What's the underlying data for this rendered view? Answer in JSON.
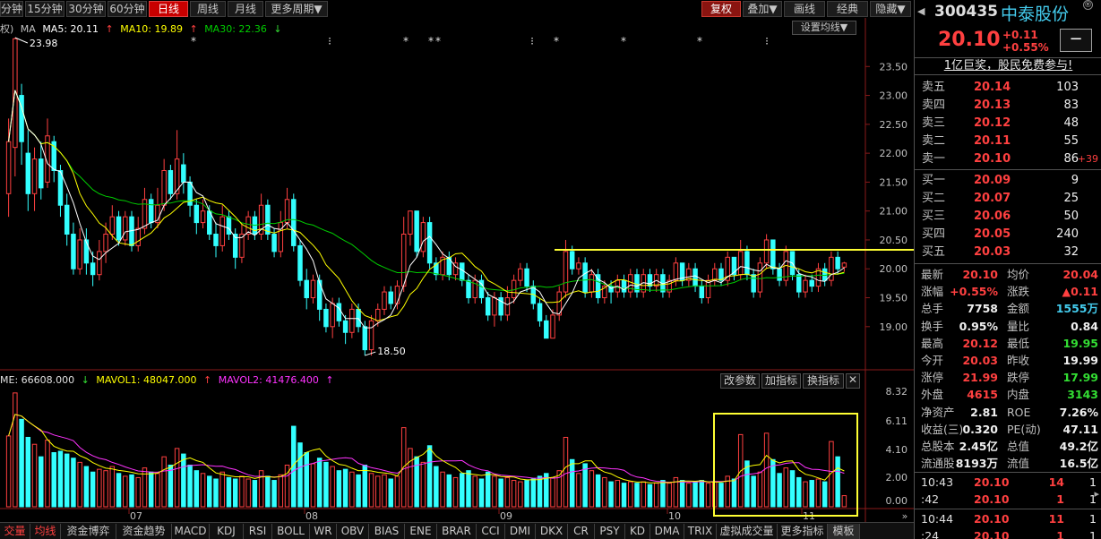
{
  "toolbar": {
    "periods": [
      {
        "label": "分钟",
        "active": false
      },
      {
        "label": "15分钟",
        "active": false
      },
      {
        "label": "30分钟",
        "active": false
      },
      {
        "label": "60分钟",
        "active": false
      },
      {
        "label": "日线",
        "active": true
      },
      {
        "label": "周线",
        "active": false
      },
      {
        "label": "月线",
        "active": false
      },
      {
        "label": "更多周期▼",
        "active": false
      }
    ],
    "right_buttons": [
      "复权",
      "叠加▼",
      "画线",
      "经典",
      "隐藏▼"
    ]
  },
  "main_legend": {
    "prefix": "权)",
    "ma_label": "MA",
    "ma5": "MA5: 20.11",
    "ma10": "MA10: 19.89",
    "ma30": "MA30: 22.36",
    "up_arrow": "↑",
    "down_arrow": "↓"
  },
  "set_ma_button": "设置均线▼",
  "high_label": "23.98",
  "low_label": "18.50",
  "price_axis": [
    "23.50",
    "23.00",
    "22.50",
    "22.00",
    "21.50",
    "21.00",
    "20.50",
    "20.00",
    "19.50",
    "19.00"
  ],
  "volume_legend": {
    "vol": "ME: 66608.000",
    "mavol1": "MAVOL1: 48047.000",
    "mavol2": "MAVOL2: 41476.400",
    "down_arrow": "↓",
    "up_arrow": "↑"
  },
  "volume_axis": [
    "8.32",
    "6.11",
    "4.10",
    "2.00",
    "0.00"
  ],
  "volume_buttons": [
    "改参数",
    "加指标",
    "换指标"
  ],
  "date_axis": [
    "07",
    "08",
    "09",
    "10",
    "11"
  ],
  "bottom_tabs": [
    "交量",
    "均线",
    "资金博弈",
    "资金趋势",
    "MACD",
    "KDJ",
    "RSI",
    "BOLL",
    "WR",
    "OBV",
    "BIAS",
    "ENE",
    "BRAR",
    "CCI",
    "DMI",
    "DKX",
    "CR",
    "PSY",
    "KD",
    "DMA",
    "TRIX",
    "虚拟成交量",
    "更多指标",
    "模板"
  ],
  "colors": {
    "up": "#ff4040",
    "down": "#33ffff",
    "ma5": "#ffffff",
    "ma10": "#ffff00",
    "ma30": "#00cc00",
    "mavol2": "#ff33ff",
    "annotation": "#ffff33"
  },
  "panel": {
    "code": "300435",
    "name": "中泰股份",
    "badge": "®",
    "price": "20.10",
    "change": "+0.11",
    "change_pct": "+0.55%",
    "minus": "−",
    "ad": "1亿巨奖，股民免费参与!",
    "asks": [
      {
        "label": "卖五",
        "price": "20.14",
        "vol": "103",
        "chg": ""
      },
      {
        "label": "卖四",
        "price": "20.13",
        "vol": "83",
        "chg": ""
      },
      {
        "label": "卖三",
        "price": "20.12",
        "vol": "48",
        "chg": ""
      },
      {
        "label": "卖二",
        "price": "20.11",
        "vol": "55",
        "chg": ""
      },
      {
        "label": "卖一",
        "price": "20.10",
        "vol": "86",
        "chg": "+39"
      }
    ],
    "bids": [
      {
        "label": "买一",
        "price": "20.09",
        "vol": "9"
      },
      {
        "label": "买二",
        "price": "20.07",
        "vol": "25"
      },
      {
        "label": "买三",
        "price": "20.06",
        "vol": "50"
      },
      {
        "label": "买四",
        "price": "20.05",
        "vol": "240"
      },
      {
        "label": "买五",
        "price": "20.03",
        "vol": "32"
      }
    ],
    "stats": [
      {
        "l1": "最新",
        "v1": "20.10",
        "c1": "red",
        "l2": "均价",
        "v2": "20.04",
        "c2": "red"
      },
      {
        "l1": "涨幅",
        "v1": "+0.55%",
        "c1": "red",
        "l2": "涨跌",
        "v2": "▲0.11",
        "c2": "red"
      },
      {
        "l1": "总手",
        "v1": "7758",
        "c1": "wht",
        "l2": "金额",
        "v2": "1555万",
        "c2": "cyan"
      },
      {
        "l1": "换手",
        "v1": "0.95%",
        "c1": "wht",
        "l2": "量比",
        "v2": "0.84",
        "c2": "wht"
      },
      {
        "l1": "最高",
        "v1": "20.12",
        "c1": "red",
        "l2": "最低",
        "v2": "19.95",
        "c2": "grn"
      },
      {
        "l1": "今开",
        "v1": "20.03",
        "c1": "red",
        "l2": "昨收",
        "v2": "19.99",
        "c2": "wht"
      },
      {
        "l1": "涨停",
        "v1": "21.99",
        "c1": "red",
        "l2": "跌停",
        "v2": "17.99",
        "c2": "grn"
      },
      {
        "l1": "外盘",
        "v1": "4615",
        "c1": "red",
        "l2": "内盘",
        "v2": "3143",
        "c2": "grn"
      },
      {
        "l1": "净资产",
        "v1": "2.81",
        "c1": "wht",
        "l2": "ROE",
        "v2": "7.26%",
        "c2": "wht"
      },
      {
        "l1": "收益(三)",
        "v1": "0.320",
        "c1": "wht",
        "l2": "PE(动)",
        "v2": "47.11",
        "c2": "wht"
      },
      {
        "l1": "总股本",
        "v1": "2.45亿",
        "c1": "wht",
        "l2": "总值",
        "v2": "49.2亿",
        "c2": "wht"
      },
      {
        "l1": "流通股",
        "v1": "8193万",
        "c1": "wht",
        "l2": "流值",
        "v2": "16.5亿",
        "c2": "wht"
      }
    ],
    "ticks": [
      {
        "time": "10:43",
        "price": "20.10",
        "vol": "14",
        "n": "1"
      },
      {
        "time": ":42",
        "price": "20.10",
        "vol": "1",
        "n": "1"
      },
      {
        "time": "10:44",
        "price": "20.10",
        "vol": "11",
        "n": "1"
      },
      {
        "time": ":24",
        "price": "20.10",
        "vol": "1",
        "n": "1"
      }
    ]
  },
  "chart_data": {
    "type": "candlestick",
    "price_range": [
      18.3,
      24.0
    ],
    "volume_range": [
      0,
      8.32
    ],
    "resistance_line": 20.33,
    "candles": [
      [
        21.3,
        22.2,
        22.6,
        20.9,
        5.1
      ],
      [
        22.1,
        23.98,
        24.0,
        21.6,
        8.2
      ],
      [
        23.0,
        22.2,
        23.2,
        21.8,
        6.3
      ],
      [
        22.0,
        21.3,
        22.4,
        21.0,
        5.0
      ],
      [
        21.3,
        21.9,
        22.1,
        21.0,
        4.5
      ],
      [
        21.9,
        21.4,
        22.2,
        21.2,
        3.6
      ],
      [
        21.5,
        22.3,
        22.6,
        21.4,
        4.8
      ],
      [
        22.2,
        21.7,
        22.3,
        21.5,
        3.9
      ],
      [
        21.7,
        21.1,
        21.8,
        20.9,
        4.0
      ],
      [
        21.1,
        20.6,
        21.3,
        20.4,
        3.8
      ],
      [
        20.6,
        20.0,
        20.8,
        19.9,
        3.5
      ],
      [
        20.0,
        20.5,
        20.7,
        19.9,
        3.2
      ],
      [
        20.5,
        20.1,
        20.7,
        19.9,
        2.9
      ],
      [
        20.1,
        19.9,
        20.3,
        19.7,
        2.5
      ],
      [
        19.9,
        20.3,
        20.5,
        19.8,
        2.7
      ],
      [
        20.3,
        20.6,
        20.8,
        20.1,
        2.6
      ],
      [
        20.6,
        20.9,
        21.1,
        20.5,
        2.9
      ],
      [
        20.9,
        20.5,
        21.0,
        20.4,
        2.4
      ],
      [
        20.5,
        20.9,
        21.0,
        20.4,
        2.2
      ],
      [
        20.9,
        20.4,
        21.0,
        20.3,
        2.3
      ],
      [
        20.4,
        20.7,
        20.9,
        20.3,
        2.1
      ],
      [
        20.7,
        21.2,
        21.4,
        20.6,
        2.8
      ],
      [
        21.2,
        20.8,
        21.3,
        20.7,
        2.5
      ],
      [
        20.8,
        21.1,
        21.4,
        20.7,
        2.4
      ],
      [
        21.1,
        21.7,
        21.9,
        21.0,
        3.6
      ],
      [
        21.7,
        21.3,
        21.8,
        21.2,
        3.0
      ],
      [
        21.3,
        21.9,
        22.4,
        21.2,
        4.2
      ],
      [
        21.8,
        21.5,
        22.0,
        21.3,
        3.8
      ],
      [
        21.5,
        21.1,
        21.6,
        20.9,
        3.0
      ],
      [
        21.1,
        20.8,
        21.2,
        20.6,
        2.6
      ],
      [
        20.8,
        21.0,
        21.2,
        20.7,
        2.4
      ],
      [
        21.0,
        20.6,
        21.1,
        20.5,
        2.2
      ],
      [
        20.6,
        20.4,
        20.8,
        20.2,
        2.0
      ],
      [
        20.4,
        20.9,
        21.1,
        20.3,
        2.5
      ],
      [
        20.9,
        20.6,
        21.0,
        20.5,
        2.1
      ],
      [
        20.6,
        20.2,
        20.7,
        20.0,
        2.0
      ],
      [
        20.2,
        20.6,
        20.8,
        20.1,
        2.2
      ],
      [
        20.6,
        20.9,
        21.0,
        20.5,
        2.0
      ],
      [
        20.9,
        20.6,
        21.0,
        20.5,
        1.9
      ],
      [
        20.6,
        21.1,
        21.3,
        20.5,
        2.6
      ],
      [
        21.1,
        20.6,
        21.2,
        20.5,
        2.2
      ],
      [
        20.6,
        20.3,
        20.7,
        20.2,
        1.9
      ],
      [
        20.3,
        20.8,
        21.0,
        20.2,
        2.3
      ],
      [
        20.8,
        21.2,
        21.4,
        20.7,
        3.0
      ],
      [
        21.2,
        20.4,
        21.3,
        20.3,
        5.8
      ],
      [
        20.4,
        19.8,
        20.5,
        19.7,
        4.6
      ],
      [
        19.8,
        19.5,
        20.0,
        19.3,
        3.9
      ],
      [
        19.5,
        19.8,
        19.9,
        19.4,
        3.1
      ],
      [
        19.8,
        19.3,
        19.9,
        19.1,
        3.5
      ],
      [
        19.3,
        19.0,
        19.4,
        18.9,
        3.2
      ],
      [
        19.0,
        19.4,
        19.5,
        18.8,
        2.9
      ],
      [
        19.4,
        19.1,
        19.5,
        19.0,
        2.6
      ],
      [
        19.1,
        18.9,
        19.2,
        18.7,
        2.7
      ],
      [
        18.9,
        19.3,
        19.4,
        18.8,
        2.5
      ],
      [
        19.3,
        19.0,
        19.4,
        18.9,
        2.3
      ],
      [
        19.0,
        18.6,
        19.1,
        18.5,
        3.0
      ],
      [
        18.6,
        19.1,
        19.2,
        18.5,
        2.4
      ],
      [
        19.1,
        19.3,
        19.4,
        19.0,
        2.2
      ],
      [
        19.3,
        19.6,
        19.7,
        19.2,
        2.3
      ],
      [
        19.6,
        19.4,
        19.7,
        19.3,
        2.0
      ],
      [
        19.4,
        19.7,
        19.8,
        19.3,
        2.2
      ],
      [
        19.7,
        20.6,
        20.9,
        19.6,
        5.7
      ],
      [
        20.6,
        21.0,
        21.0,
        20.4,
        4.2
      ],
      [
        21.0,
        20.3,
        21.0,
        20.2,
        3.6
      ],
      [
        20.3,
        20.8,
        20.9,
        20.2,
        3.2
      ],
      [
        20.8,
        20.1,
        20.9,
        20.0,
        4.4
      ],
      [
        20.1,
        19.9,
        20.2,
        19.8,
        2.9
      ],
      [
        19.9,
        20.2,
        20.3,
        19.8,
        2.5
      ],
      [
        20.2,
        19.9,
        20.3,
        19.8,
        2.3
      ],
      [
        19.9,
        20.1,
        20.2,
        19.8,
        2.1
      ],
      [
        20.1,
        19.8,
        20.1,
        19.7,
        2.4
      ],
      [
        19.8,
        19.5,
        19.9,
        19.4,
        2.6
      ],
      [
        19.5,
        19.8,
        19.9,
        19.4,
        2.2
      ],
      [
        19.8,
        19.5,
        19.9,
        19.4,
        2.0
      ],
      [
        19.5,
        19.2,
        19.6,
        19.1,
        2.5
      ],
      [
        19.2,
        19.5,
        19.6,
        19.0,
        2.2
      ],
      [
        19.5,
        19.2,
        19.6,
        19.1,
        2.0
      ],
      [
        19.2,
        19.5,
        19.7,
        19.1,
        2.1
      ],
      [
        19.5,
        19.8,
        19.9,
        19.4,
        1.9
      ],
      [
        19.8,
        20.0,
        20.1,
        19.7,
        1.8
      ],
      [
        20.0,
        19.7,
        20.1,
        19.6,
        1.9
      ],
      [
        19.7,
        19.4,
        19.8,
        19.3,
        2.0
      ],
      [
        19.4,
        19.1,
        19.5,
        19.0,
        2.2
      ],
      [
        19.1,
        18.8,
        19.2,
        18.8,
        2.4
      ],
      [
        18.8,
        19.2,
        19.3,
        18.8,
        2.1
      ],
      [
        19.2,
        19.6,
        19.7,
        19.1,
        2.6
      ],
      [
        19.6,
        20.3,
        20.5,
        19.5,
        5.0
      ],
      [
        20.3,
        20.0,
        20.4,
        19.9,
        3.4
      ],
      [
        20.0,
        20.1,
        20.2,
        19.9,
        2.4
      ],
      [
        20.1,
        19.6,
        20.2,
        19.5,
        3.1
      ],
      [
        19.6,
        19.9,
        20.0,
        19.5,
        2.6
      ],
      [
        19.9,
        19.5,
        20.0,
        19.4,
        2.3
      ],
      [
        19.5,
        19.7,
        19.8,
        19.4,
        2.1
      ],
      [
        19.7,
        19.6,
        19.8,
        19.4,
        1.8
      ],
      [
        19.6,
        19.8,
        19.9,
        19.5,
        1.9
      ],
      [
        19.8,
        19.6,
        19.9,
        19.5,
        1.7
      ],
      [
        19.6,
        19.9,
        20.0,
        19.5,
        1.8
      ],
      [
        19.9,
        19.6,
        20.0,
        19.5,
        1.7
      ],
      [
        19.6,
        19.9,
        20.0,
        19.5,
        1.8
      ],
      [
        19.9,
        19.7,
        20.0,
        19.6,
        1.6
      ],
      [
        19.7,
        19.9,
        20.0,
        19.6,
        1.7
      ],
      [
        19.9,
        19.6,
        20.0,
        19.5,
        1.9
      ],
      [
        19.6,
        19.8,
        19.9,
        19.5,
        1.7
      ],
      [
        19.8,
        20.1,
        20.2,
        19.7,
        2.1
      ],
      [
        20.1,
        19.8,
        20.1,
        19.7,
        1.9
      ],
      [
        19.8,
        20.0,
        20.1,
        19.7,
        1.7
      ],
      [
        20.0,
        19.7,
        20.1,
        19.6,
        1.8
      ],
      [
        19.7,
        19.5,
        19.8,
        19.4,
        1.9
      ],
      [
        19.5,
        19.8,
        19.9,
        19.4,
        1.7
      ],
      [
        19.8,
        20.0,
        20.1,
        19.7,
        1.8
      ],
      [
        20.0,
        19.8,
        20.1,
        19.7,
        1.7
      ],
      [
        19.8,
        20.2,
        20.3,
        19.7,
        2.2
      ],
      [
        20.2,
        19.9,
        20.2,
        19.8,
        2.0
      ],
      [
        19.9,
        20.3,
        20.5,
        19.8,
        5.2
      ],
      [
        20.3,
        19.9,
        20.4,
        19.8,
        3.3
      ],
      [
        19.9,
        19.6,
        20.0,
        19.5,
        2.2
      ],
      [
        19.6,
        20.1,
        20.2,
        19.5,
        2.5
      ],
      [
        20.1,
        20.5,
        20.6,
        20.0,
        5.3
      ],
      [
        20.5,
        20.0,
        20.5,
        19.9,
        3.4
      ],
      [
        20.0,
        19.8,
        20.1,
        19.7,
        2.4
      ],
      [
        19.8,
        20.3,
        20.4,
        19.7,
        2.8
      ],
      [
        20.3,
        19.9,
        20.3,
        19.8,
        2.6
      ],
      [
        19.9,
        19.6,
        20.0,
        19.5,
        2.1
      ],
      [
        19.6,
        19.8,
        19.9,
        19.5,
        1.8
      ],
      [
        19.8,
        19.7,
        19.9,
        19.6,
        1.9
      ],
      [
        19.7,
        20.0,
        20.1,
        19.6,
        2.0
      ],
      [
        20.0,
        19.8,
        20.1,
        19.7,
        1.8
      ],
      [
        19.8,
        20.2,
        20.3,
        19.7,
        4.7
      ],
      [
        20.2,
        20.0,
        20.3,
        19.9,
        3.6
      ],
      [
        20.03,
        20.1,
        20.12,
        19.95,
        0.8
      ]
    ]
  }
}
